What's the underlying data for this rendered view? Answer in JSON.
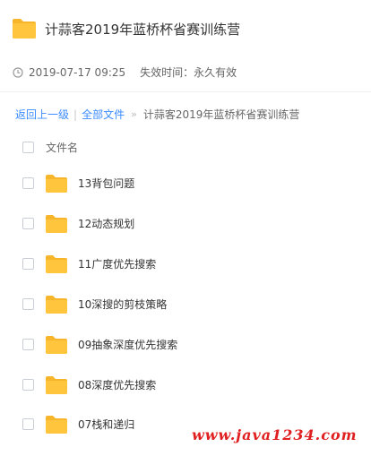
{
  "share": {
    "title": "计蒜客2019年蓝桥杯省赛训练营",
    "date": "2019-07-17 09:25",
    "expiry": "失效时间：永久有效"
  },
  "breadcrumb": {
    "back": "返回上一级",
    "separator": "|",
    "all_files": "全部文件",
    "arrow": "»",
    "current": "计蒜客2019年蓝桥杯省赛训练营"
  },
  "list": {
    "column_name": "文件名",
    "items": [
      {
        "name": "13背包问题"
      },
      {
        "name": "12动态规划"
      },
      {
        "name": "11广度优先搜索"
      },
      {
        "name": "10深搜的剪枝策略"
      },
      {
        "name": "09抽象深度优先搜索"
      },
      {
        "name": "08深度优先搜索"
      },
      {
        "name": "07栈和递归"
      }
    ]
  },
  "watermark": "www.java1234.com",
  "icons": {
    "folder": "folder-icon",
    "clock": "clock-icon",
    "checkbox": "checkbox"
  },
  "colors": {
    "folder": "#ffc53d",
    "folder_tab": "#f7b52c",
    "link": "#3b8cff",
    "watermark": "#e02020"
  }
}
